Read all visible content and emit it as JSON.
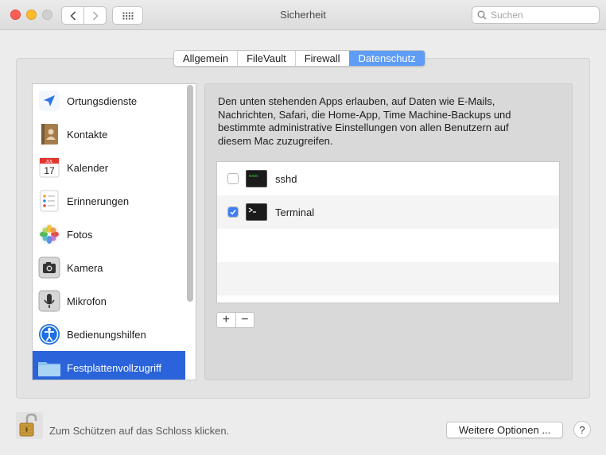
{
  "window": {
    "title": "Sicherheit"
  },
  "search": {
    "placeholder": "Suchen",
    "value": ""
  },
  "tabs": [
    {
      "label": "Allgemein",
      "active": false
    },
    {
      "label": "FileVault",
      "active": false
    },
    {
      "label": "Firewall",
      "active": false
    },
    {
      "label": "Datenschutz",
      "active": true
    }
  ],
  "sidebar": {
    "items": [
      {
        "label": "Ortungsdienste",
        "icon": "location-arrow-icon"
      },
      {
        "label": "Kontakte",
        "icon": "contacts-book-icon"
      },
      {
        "label": "Kalender",
        "icon": "calendar-icon",
        "icon_month": "JUL",
        "icon_day": "17"
      },
      {
        "label": "Erinnerungen",
        "icon": "reminders-list-icon"
      },
      {
        "label": "Fotos",
        "icon": "photos-flower-icon"
      },
      {
        "label": "Kamera",
        "icon": "camera-icon"
      },
      {
        "label": "Mikrofon",
        "icon": "microphone-icon"
      },
      {
        "label": "Bedienungshilfen",
        "icon": "accessibility-icon"
      },
      {
        "label": "Festplattenvollzugriff",
        "icon": "folder-icon",
        "selected": true
      }
    ]
  },
  "content": {
    "description": "Den unten stehenden Apps erlauben, auf Daten wie E-Mails, Nachrichten, Safari, die Home-App, Time Machine-Backups und bestimmte administrative Einstellungen von allen Benutzern auf diesem Mac zuzugreifen.",
    "apps": [
      {
        "name": "sshd",
        "checked": false,
        "icon": "terminal-exec-icon"
      },
      {
        "name": "Terminal",
        "checked": true,
        "icon": "terminal-icon"
      }
    ],
    "add_label": "+",
    "remove_label": "−"
  },
  "footer": {
    "lock_text": "Zum Schützen auf das Schloss klicken.",
    "more_options_label": "Weitere Optionen ...",
    "help_label": "?"
  },
  "colors": {
    "accent": "#2a63da",
    "tab_active": "#5e9cf5",
    "checkbox": "#3d7ef5"
  }
}
